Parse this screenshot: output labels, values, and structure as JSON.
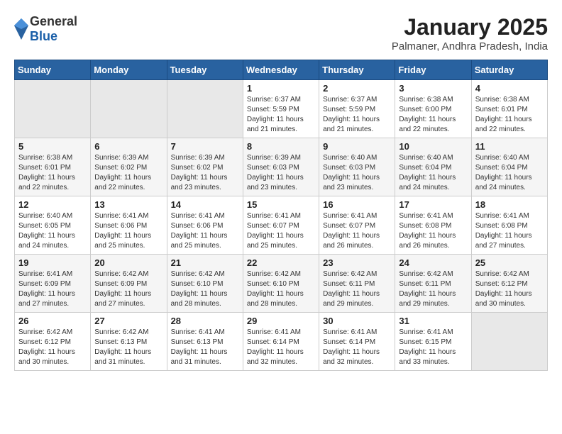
{
  "header": {
    "logo_general": "General",
    "logo_blue": "Blue",
    "month_title": "January 2025",
    "location": "Palmaner, Andhra Pradesh, India"
  },
  "weekdays": [
    "Sunday",
    "Monday",
    "Tuesday",
    "Wednesday",
    "Thursday",
    "Friday",
    "Saturday"
  ],
  "weeks": [
    [
      {
        "day": "",
        "info": ""
      },
      {
        "day": "",
        "info": ""
      },
      {
        "day": "",
        "info": ""
      },
      {
        "day": "1",
        "info": "Sunrise: 6:37 AM\nSunset: 5:59 PM\nDaylight: 11 hours and 21 minutes."
      },
      {
        "day": "2",
        "info": "Sunrise: 6:37 AM\nSunset: 5:59 PM\nDaylight: 11 hours and 21 minutes."
      },
      {
        "day": "3",
        "info": "Sunrise: 6:38 AM\nSunset: 6:00 PM\nDaylight: 11 hours and 22 minutes."
      },
      {
        "day": "4",
        "info": "Sunrise: 6:38 AM\nSunset: 6:01 PM\nDaylight: 11 hours and 22 minutes."
      }
    ],
    [
      {
        "day": "5",
        "info": "Sunrise: 6:38 AM\nSunset: 6:01 PM\nDaylight: 11 hours and 22 minutes."
      },
      {
        "day": "6",
        "info": "Sunrise: 6:39 AM\nSunset: 6:02 PM\nDaylight: 11 hours and 22 minutes."
      },
      {
        "day": "7",
        "info": "Sunrise: 6:39 AM\nSunset: 6:02 PM\nDaylight: 11 hours and 23 minutes."
      },
      {
        "day": "8",
        "info": "Sunrise: 6:39 AM\nSunset: 6:03 PM\nDaylight: 11 hours and 23 minutes."
      },
      {
        "day": "9",
        "info": "Sunrise: 6:40 AM\nSunset: 6:03 PM\nDaylight: 11 hours and 23 minutes."
      },
      {
        "day": "10",
        "info": "Sunrise: 6:40 AM\nSunset: 6:04 PM\nDaylight: 11 hours and 24 minutes."
      },
      {
        "day": "11",
        "info": "Sunrise: 6:40 AM\nSunset: 6:04 PM\nDaylight: 11 hours and 24 minutes."
      }
    ],
    [
      {
        "day": "12",
        "info": "Sunrise: 6:40 AM\nSunset: 6:05 PM\nDaylight: 11 hours and 24 minutes."
      },
      {
        "day": "13",
        "info": "Sunrise: 6:41 AM\nSunset: 6:06 PM\nDaylight: 11 hours and 25 minutes."
      },
      {
        "day": "14",
        "info": "Sunrise: 6:41 AM\nSunset: 6:06 PM\nDaylight: 11 hours and 25 minutes."
      },
      {
        "day": "15",
        "info": "Sunrise: 6:41 AM\nSunset: 6:07 PM\nDaylight: 11 hours and 25 minutes."
      },
      {
        "day": "16",
        "info": "Sunrise: 6:41 AM\nSunset: 6:07 PM\nDaylight: 11 hours and 26 minutes."
      },
      {
        "day": "17",
        "info": "Sunrise: 6:41 AM\nSunset: 6:08 PM\nDaylight: 11 hours and 26 minutes."
      },
      {
        "day": "18",
        "info": "Sunrise: 6:41 AM\nSunset: 6:08 PM\nDaylight: 11 hours and 27 minutes."
      }
    ],
    [
      {
        "day": "19",
        "info": "Sunrise: 6:41 AM\nSunset: 6:09 PM\nDaylight: 11 hours and 27 minutes."
      },
      {
        "day": "20",
        "info": "Sunrise: 6:42 AM\nSunset: 6:09 PM\nDaylight: 11 hours and 27 minutes."
      },
      {
        "day": "21",
        "info": "Sunrise: 6:42 AM\nSunset: 6:10 PM\nDaylight: 11 hours and 28 minutes."
      },
      {
        "day": "22",
        "info": "Sunrise: 6:42 AM\nSunset: 6:10 PM\nDaylight: 11 hours and 28 minutes."
      },
      {
        "day": "23",
        "info": "Sunrise: 6:42 AM\nSunset: 6:11 PM\nDaylight: 11 hours and 29 minutes."
      },
      {
        "day": "24",
        "info": "Sunrise: 6:42 AM\nSunset: 6:11 PM\nDaylight: 11 hours and 29 minutes."
      },
      {
        "day": "25",
        "info": "Sunrise: 6:42 AM\nSunset: 6:12 PM\nDaylight: 11 hours and 30 minutes."
      }
    ],
    [
      {
        "day": "26",
        "info": "Sunrise: 6:42 AM\nSunset: 6:12 PM\nDaylight: 11 hours and 30 minutes."
      },
      {
        "day": "27",
        "info": "Sunrise: 6:42 AM\nSunset: 6:13 PM\nDaylight: 11 hours and 31 minutes."
      },
      {
        "day": "28",
        "info": "Sunrise: 6:41 AM\nSunset: 6:13 PM\nDaylight: 11 hours and 31 minutes."
      },
      {
        "day": "29",
        "info": "Sunrise: 6:41 AM\nSunset: 6:14 PM\nDaylight: 11 hours and 32 minutes."
      },
      {
        "day": "30",
        "info": "Sunrise: 6:41 AM\nSunset: 6:14 PM\nDaylight: 11 hours and 32 minutes."
      },
      {
        "day": "31",
        "info": "Sunrise: 6:41 AM\nSunset: 6:15 PM\nDaylight: 11 hours and 33 minutes."
      },
      {
        "day": "",
        "info": ""
      }
    ]
  ]
}
